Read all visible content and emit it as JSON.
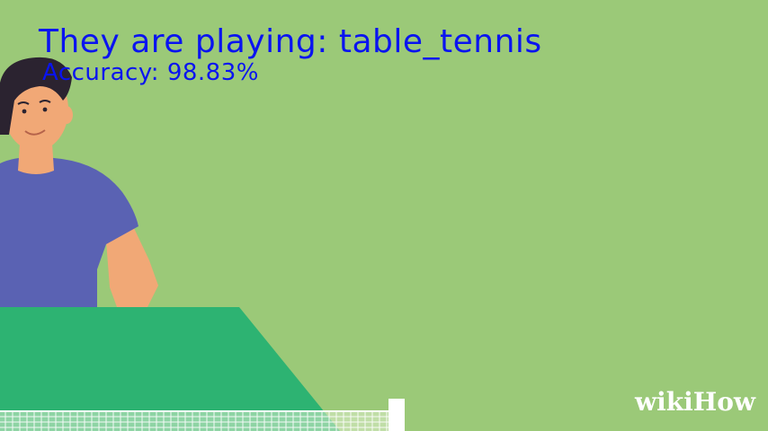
{
  "overlay": {
    "title": "They are playing: table_tennis",
    "accuracy": "Accuracy: 98.83%"
  },
  "watermark": {
    "text": "wikiHow"
  },
  "colors": {
    "background": "#9bc978",
    "table": "#2db372",
    "shirt": "#5a62b3",
    "skin": "#f1a876",
    "hair": "#2b2330",
    "overlay_text": "#0a14f0",
    "watermark": "#ffffff"
  }
}
